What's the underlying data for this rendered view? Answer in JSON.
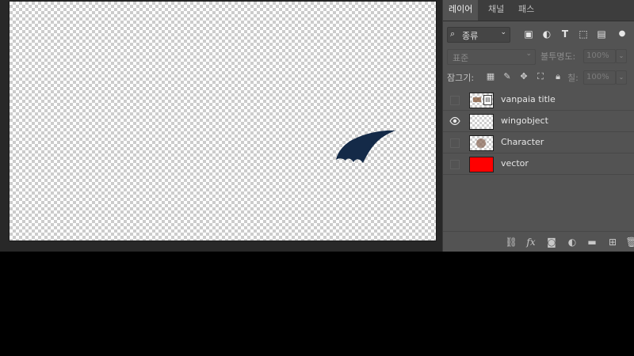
{
  "panel": {
    "tabs": [
      {
        "label": "레이어",
        "active": true
      },
      {
        "label": "채널",
        "active": false
      },
      {
        "label": "패스",
        "active": false
      }
    ],
    "filter": {
      "value": "종류"
    },
    "blend_mode": {
      "value": "표준"
    },
    "opacity": {
      "label": "불투명도:",
      "value": "100%"
    },
    "lock": {
      "label": "잠그기:"
    },
    "fill": {
      "label": "칠:",
      "value": "100%"
    },
    "layers": [
      {
        "name": "vanpaia title",
        "visible": false,
        "thumb": "title-thumbnail"
      },
      {
        "name": "wingobject",
        "visible": true,
        "thumb": "transparent-thumbnail"
      },
      {
        "name": "Character",
        "visible": false,
        "thumb": "character-thumbnail"
      },
      {
        "name": "vector",
        "visible": false,
        "thumb": "red-fill-thumbnail",
        "thumb_color": "#ff0000"
      }
    ]
  },
  "colors": {
    "wing_fill": "#142a48",
    "panel_bg": "#535353",
    "canvas_bg": "#282828"
  }
}
